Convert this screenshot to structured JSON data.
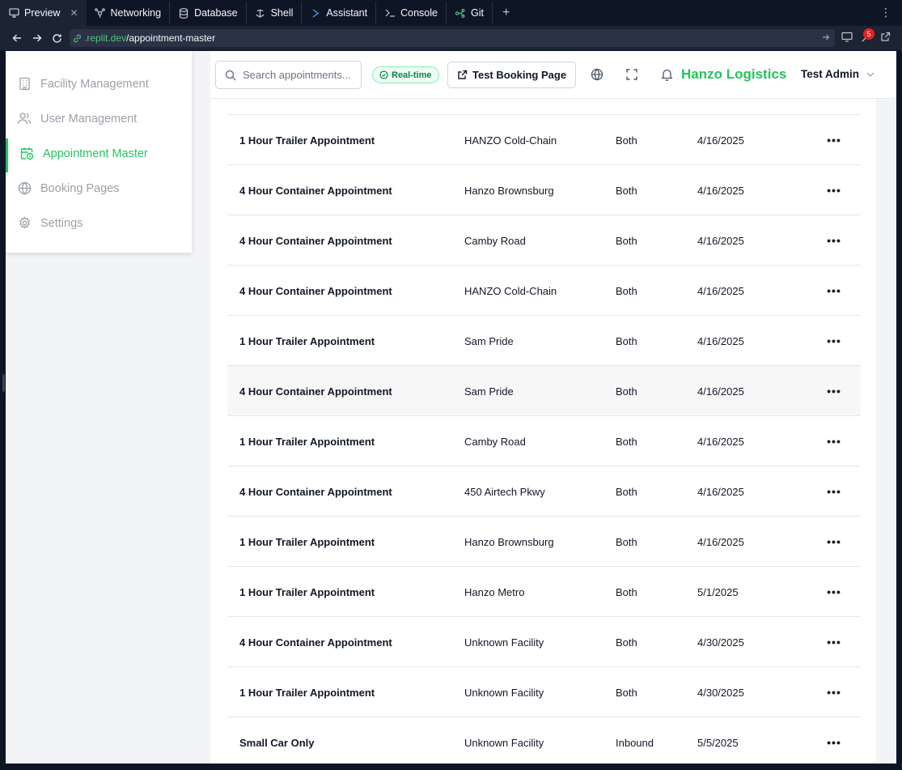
{
  "ide_tabs": [
    {
      "label": "Preview",
      "icon": "monitor-icon",
      "active": true
    },
    {
      "label": "Networking",
      "icon": "network-icon"
    },
    {
      "label": "Database",
      "icon": "database-icon"
    },
    {
      "label": "Shell",
      "icon": "shell-icon"
    },
    {
      "label": "Assistant",
      "icon": "assistant-icon"
    },
    {
      "label": "Console",
      "icon": "console-icon"
    },
    {
      "label": "Git",
      "icon": "git-icon"
    }
  ],
  "url": {
    "domain": ".replit.dev",
    "path": "/appointment-master"
  },
  "notification_count": "5",
  "sidebar": {
    "items": [
      {
        "label": "Facility Management",
        "icon": "building-icon"
      },
      {
        "label": "User Management",
        "icon": "users-icon"
      },
      {
        "label": "Appointment Master",
        "icon": "calendar-clock-icon",
        "active": true
      },
      {
        "label": "Booking Pages",
        "icon": "globe-icon"
      },
      {
        "label": "Settings",
        "icon": "gear-icon"
      }
    ]
  },
  "header": {
    "search_placeholder": "Search appointments...",
    "realtime_label": "Real-time",
    "test_booking_label": "Test Booking Page",
    "brand": "Hanzo Logistics",
    "user": "Test Admin"
  },
  "table": {
    "rows": [
      {
        "type": "1 Hour Trailer Appointment",
        "facility": "HANZO Cold-Chain",
        "direction": "Both",
        "date": "4/16/2025"
      },
      {
        "type": "4 Hour Container Appointment",
        "facility": "Hanzo Brownsburg",
        "direction": "Both",
        "date": "4/16/2025"
      },
      {
        "type": "4 Hour Container Appointment",
        "facility": "Camby Road",
        "direction": "Both",
        "date": "4/16/2025"
      },
      {
        "type": "4 Hour Container Appointment",
        "facility": "HANZO Cold-Chain",
        "direction": "Both",
        "date": "4/16/2025"
      },
      {
        "type": "1 Hour Trailer Appointment",
        "facility": "Sam Pride",
        "direction": "Both",
        "date": "4/16/2025"
      },
      {
        "type": "4 Hour Container Appointment",
        "facility": "Sam Pride",
        "direction": "Both",
        "date": "4/16/2025",
        "highlighted": true
      },
      {
        "type": "1 Hour Trailer Appointment",
        "facility": "Camby Road",
        "direction": "Both",
        "date": "4/16/2025"
      },
      {
        "type": "4 Hour Container Appointment",
        "facility": "450 Airtech Pkwy",
        "direction": "Both",
        "date": "4/16/2025"
      },
      {
        "type": "1 Hour Trailer Appointment",
        "facility": "Hanzo Brownsburg",
        "direction": "Both",
        "date": "4/16/2025"
      },
      {
        "type": "1 Hour Trailer Appointment",
        "facility": "Hanzo Metro",
        "direction": "Both",
        "date": "5/1/2025"
      },
      {
        "type": "4 Hour Container Appointment",
        "facility": "Unknown Facility",
        "direction": "Both",
        "date": "4/30/2025"
      },
      {
        "type": "1 Hour Trailer Appointment",
        "facility": "Unknown Facility",
        "direction": "Both",
        "date": "4/30/2025"
      },
      {
        "type": "Small Car Only",
        "facility": "Unknown Facility",
        "direction": "Inbound",
        "date": "5/5/2025"
      }
    ],
    "actions_label": "•••"
  },
  "colors": {
    "accent": "#22c55e",
    "ide_bg": "#0e1525",
    "ide_panel": "#1c2333"
  }
}
